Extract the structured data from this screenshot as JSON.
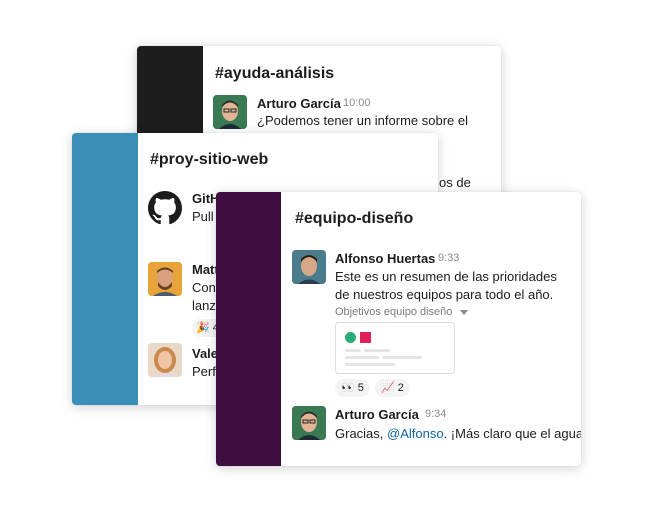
{
  "colors": {
    "dark_sidebar": "#1d1d1d",
    "blue_sidebar": "#3a8fb8",
    "aubergine_sidebar": "#3f0e40",
    "mention": "#1264a3",
    "file_green": "#2bac76",
    "file_pink": "#e01e5a"
  },
  "back_card": {
    "channel": "#ayuda-análisis",
    "author": "Arturo García",
    "time": "10:00",
    "line1": "¿Podemos tener un informe sobre el",
    "line2_fragment": "os de"
  },
  "middle_card": {
    "channel": "#proy-sitio-web",
    "messages": [
      {
        "author": "GitH",
        "line1": "Pull",
        "avatar": "github-icon"
      },
      {
        "author": "Matt",
        "line1": "Con",
        "line2": "lanz",
        "reaction_count": "4",
        "avatar": "avatar-photo"
      },
      {
        "author": "Vale",
        "line1": "Perf",
        "avatar": "avatar-photo"
      }
    ]
  },
  "front_card": {
    "channel": "#equipo-diseño",
    "message1": {
      "author": "Alfonso Huertas",
      "time": "9:33",
      "line1": "Este es un resumen de las prioridades",
      "line2": "de nuestros equipos para todo el año.",
      "file_title": "Objetivos equipo diseño",
      "reactions": [
        {
          "icon": "eyes-icon",
          "count": "5"
        },
        {
          "icon": "chart-increasing-icon",
          "count": "2"
        }
      ]
    },
    "message2": {
      "author": "Arturo García",
      "time": "9:34",
      "text_before": "Gracias, ",
      "mention": "@Alfonso",
      "text_after": ". ¡Más claro que el agua!"
    }
  }
}
